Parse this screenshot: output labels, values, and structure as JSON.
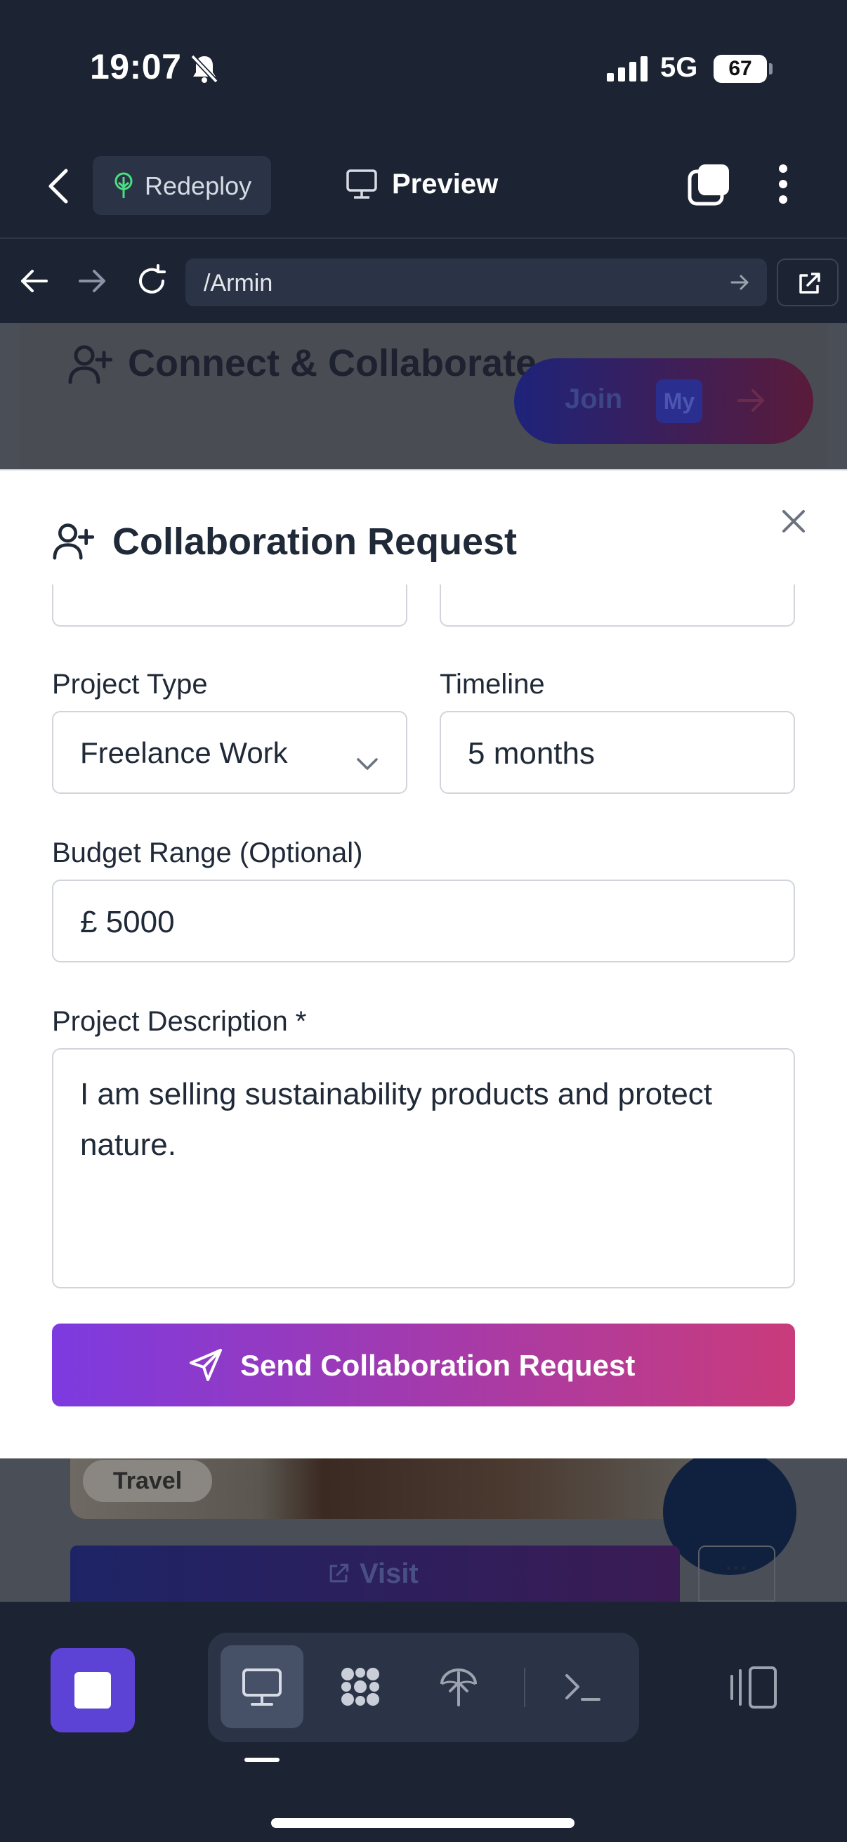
{
  "status_bar": {
    "time": "19:07",
    "network": "5G",
    "battery": "67"
  },
  "header": {
    "redeploy_label": "Redeploy",
    "preview_label": "Preview"
  },
  "browser": {
    "url": "/Armin"
  },
  "background_page": {
    "heading": "Connect & Collaborate",
    "join_label": "Join",
    "my_badge": "My",
    "travel_chip": "Travel",
    "visit_label": "Visit",
    "more_label": "···"
  },
  "modal": {
    "title": "Collaboration Request",
    "project_type": {
      "label": "Project Type",
      "value": "Freelance Work"
    },
    "timeline": {
      "label": "Timeline",
      "value": "5 months"
    },
    "budget": {
      "label": "Budget Range (Optional)",
      "value": "£ 5000"
    },
    "description": {
      "label": "Project Description *",
      "value": "I am selling sustainability products and protect nature."
    },
    "submit_label": "Send Collaboration Request"
  },
  "colors": {
    "chrome": "#1c2333",
    "accent_start": "#7d3ae0",
    "accent_end": "#c93b7b",
    "stop_button": "#5c43d6"
  },
  "icons": [
    "bell-slash-icon",
    "signal-icon",
    "chevron-left-icon",
    "tree-icon",
    "monitor-icon",
    "tabs-icon",
    "more-vertical-icon",
    "arrow-left-icon",
    "arrow-right-icon",
    "reload-icon",
    "external-link-icon",
    "user-plus-icon",
    "close-icon",
    "chevron-down-icon",
    "send-icon",
    "stop-icon",
    "desktop-icon",
    "apps-icon",
    "deploy-icon",
    "terminal-icon",
    "panel-icon"
  ]
}
